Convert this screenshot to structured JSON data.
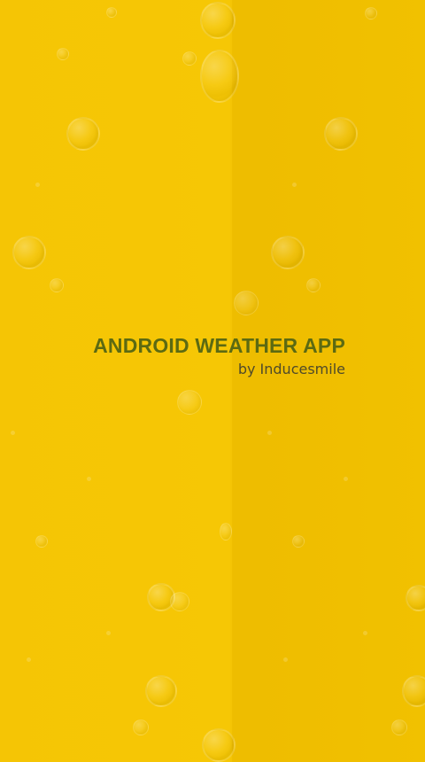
{
  "splash": {
    "title": "ANDROID WEATHER APP",
    "byline": "by Inducesmile",
    "colors": {
      "background": "#F5C400",
      "title": "#5C6A12",
      "byline": "#4F4A2A"
    },
    "background_pattern": "bubbles"
  }
}
